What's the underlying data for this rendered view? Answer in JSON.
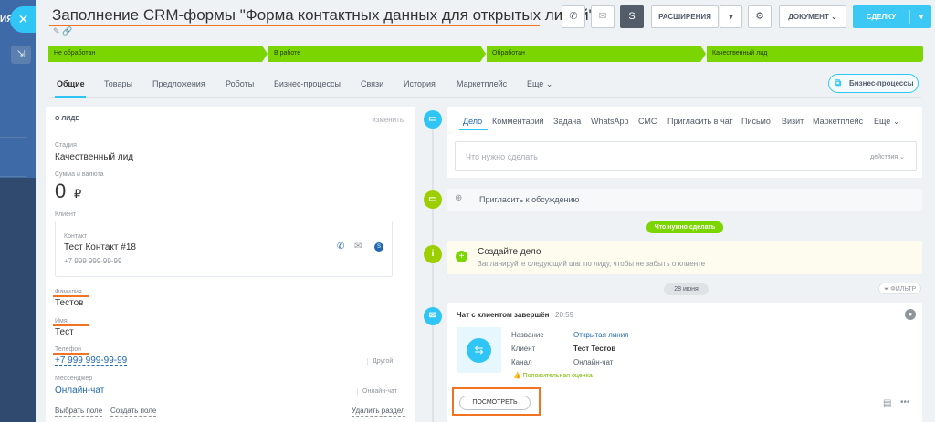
{
  "background_app": {
    "label": "ИЯ"
  },
  "header": {
    "title": "Заполнение CRM-формы \"Форма контактных данных для открытых линий\"",
    "title_tools": "✎ 🔗",
    "buttons": {
      "extensions": "РАСШИРЕНИЯ",
      "document": "ДОКУМЕНТ",
      "deal": "СДЕЛКУ"
    }
  },
  "stages": [
    {
      "label": "Не обработан"
    },
    {
      "label": "В работе"
    },
    {
      "label": "Обработан"
    },
    {
      "label": "Качественный лид"
    }
  ],
  "tabs": [
    {
      "label": "Общие",
      "active": true
    },
    {
      "label": "Товары"
    },
    {
      "label": "Предложения"
    },
    {
      "label": "Роботы"
    },
    {
      "label": "Бизнес-процессы"
    },
    {
      "label": "Связи"
    },
    {
      "label": "История"
    },
    {
      "label": "Маркетплейс"
    },
    {
      "label": "Еще ⌄"
    }
  ],
  "bp_button": "Бизнес-процессы",
  "about": {
    "heading": "О ЛИДЕ",
    "edit": "изменить",
    "stage_label": "Стадия",
    "stage_value": "Качественный лид",
    "sum_label": "Сумма и валюта",
    "sum_value": "0",
    "currency": "₽",
    "client_label": "Клиент",
    "contact_label": "Контакт",
    "contact_name": "Тест Контакт #18",
    "contact_phone": "+7 999 999-99-99",
    "lastname_label": "Фамилия",
    "lastname_value": "Тестов",
    "name_label": "Имя",
    "name_value": "Тест",
    "phone_label": "Телефон",
    "phone_value": "+7 999 999-99-99",
    "phone_type": "Другой",
    "messenger_label": "Мессенджер",
    "messenger_value": "Онлайн-чат",
    "messenger_type": "Онлайн-чат",
    "select_field": "Выбрать поле",
    "create_field": "Создать поле",
    "delete_section": "Удалить раздел"
  },
  "activity_tabs": [
    {
      "label": "Дело",
      "active": true
    },
    {
      "label": "Комментарий"
    },
    {
      "label": "Задача"
    },
    {
      "label": "WhatsApp"
    },
    {
      "label": "СМС"
    },
    {
      "label": "Пригласить в чат"
    },
    {
      "label": "Письмо"
    },
    {
      "label": "Визит"
    },
    {
      "label": "Маркетплейс"
    },
    {
      "label": "Еще ⌄"
    }
  ],
  "todo_input": {
    "placeholder": "Что нужно сделать",
    "actions": "действия ⌄"
  },
  "invite": "Пригласить к обсуждению",
  "todo_badge": "Что нужно сделать",
  "create_task": {
    "title": "Создайте дело",
    "hint": "Запланируйте следующий шаг по лиду, чтобы не забыть о клиенте"
  },
  "date_badge": "28 июня",
  "filter": "ФИЛЬТР",
  "chat": {
    "title": "Чат с клиентом завершён",
    "time": "20:59",
    "rows": [
      {
        "label": "Название",
        "value": "Открытая линия"
      },
      {
        "label": "Клиент",
        "value": "Тест Тестов"
      },
      {
        "label": "Канал",
        "value": "Онлайн-чат"
      }
    ],
    "rating": "Положительная оценка",
    "view_button": "ПОСМОТРЕТЬ"
  },
  "colors": {
    "accent": "#2fc6f6",
    "stage_green": "#7bd500",
    "highlight_orange": "#f07422",
    "link_blue": "#2067b0"
  }
}
